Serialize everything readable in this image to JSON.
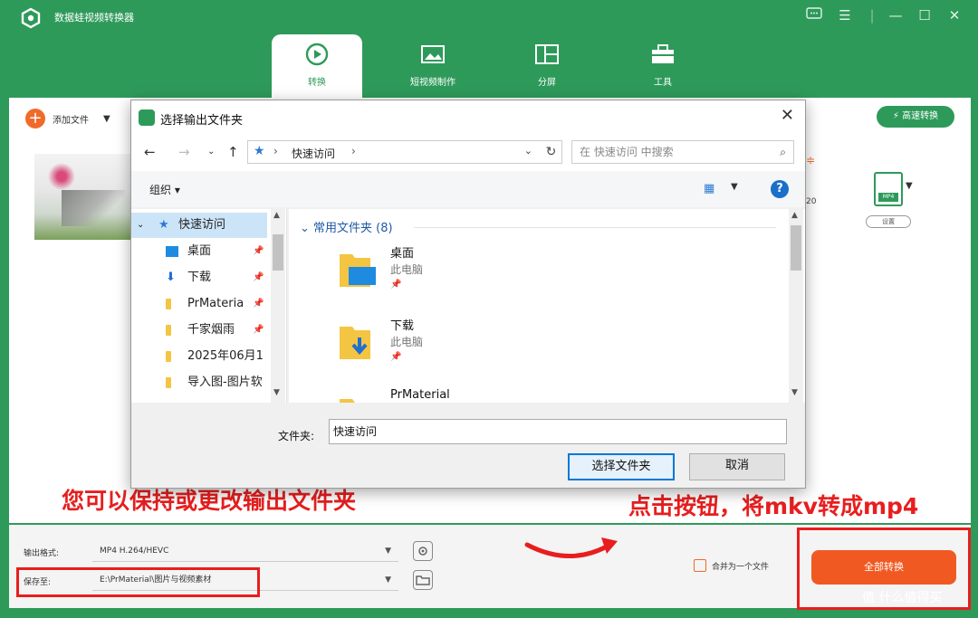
{
  "app": {
    "title": "数据蛙视频转换器"
  },
  "tabs": [
    {
      "label": "转换"
    },
    {
      "label": "短视频制作"
    },
    {
      "label": "分屏"
    },
    {
      "label": "工具"
    }
  ],
  "toolbar": {
    "add_file": "添加文件",
    "fast_convert": "高速转换"
  },
  "file_row": {
    "format_badge": "MP4",
    "settings": "设置",
    "peek_char": "≑",
    "peek_num": "20"
  },
  "bottom": {
    "output_format_label": "输出格式:",
    "output_format_value": "MP4 H.264/HEVC",
    "save_to_label": "保存至:",
    "save_to_value": "E:\\PrMaterial\\图片与视频素材",
    "merge_label": "合并为一个文件",
    "convert_all": "全部转换"
  },
  "dialog": {
    "title": "选择输出文件夹",
    "address": "快速访问",
    "search_placeholder": "在 快速访问 中搜索",
    "organize": "组织 ▾",
    "nav_items": [
      {
        "label": "快速访问"
      },
      {
        "label": "桌面"
      },
      {
        "label": "下载"
      },
      {
        "label": "PrMateria"
      },
      {
        "label": "千家烟雨"
      },
      {
        "label": "2025年06月1"
      },
      {
        "label": "导入图-图片软"
      }
    ],
    "group_header": "常用文件夹 (8)",
    "folders": [
      {
        "name": "桌面",
        "sub": "此电脑"
      },
      {
        "name": "下载",
        "sub": "此电脑"
      },
      {
        "name": "PrMaterial",
        "sub": ""
      }
    ],
    "folder_label": "文件夹:",
    "folder_value": "快速访问",
    "select_button": "选择文件夹",
    "cancel_button": "取消"
  },
  "annotations": {
    "left": "您可以保持或更改输出文件夹",
    "right": "点击按钮，将mkv转成mp4"
  },
  "watermark": "值 什么值得买",
  "colors": {
    "brand_green": "#2e9a5a",
    "accent_orange": "#f05a22",
    "annotation_red": "#e81e1e"
  }
}
